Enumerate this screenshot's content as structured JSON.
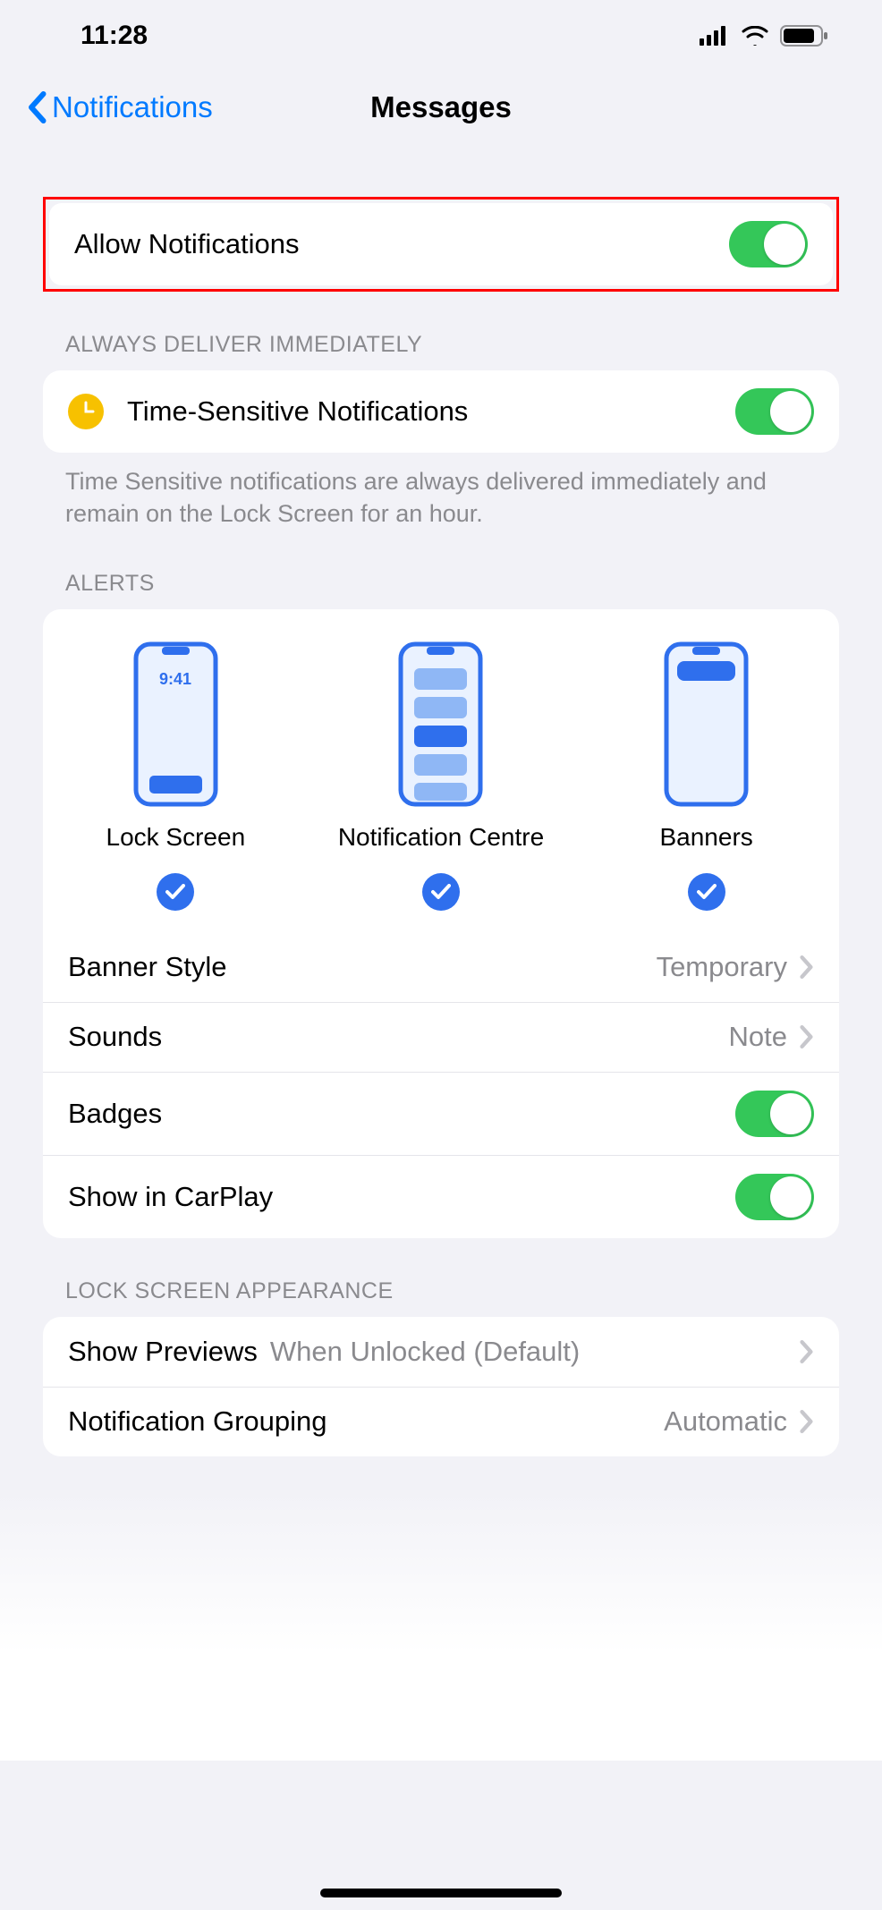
{
  "status": {
    "time": "11:28"
  },
  "nav": {
    "back": "Notifications",
    "title": "Messages"
  },
  "allow": {
    "label": "Allow Notifications"
  },
  "timeSensitive": {
    "header": "ALWAYS DELIVER IMMEDIATELY",
    "label": "Time-Sensitive Notifications",
    "footer": "Time Sensitive notifications are always delivered immediately and remain on the Lock Screen for an hour."
  },
  "alerts": {
    "header": "ALERTS",
    "options": [
      {
        "label": "Lock Screen",
        "checked": true
      },
      {
        "label": "Notification Centre",
        "checked": true
      },
      {
        "label": "Banners",
        "checked": true
      }
    ],
    "lockTime": "9:41",
    "bannerStyle": {
      "label": "Banner Style",
      "value": "Temporary"
    },
    "sounds": {
      "label": "Sounds",
      "value": "Note"
    },
    "badges": {
      "label": "Badges"
    },
    "carplay": {
      "label": "Show in CarPlay"
    }
  },
  "lockScreen": {
    "header": "LOCK SCREEN APPEARANCE",
    "previews": {
      "label": "Show Previews",
      "value": "When Unlocked (Default)"
    },
    "grouping": {
      "label": "Notification Grouping",
      "value": "Automatic"
    }
  }
}
